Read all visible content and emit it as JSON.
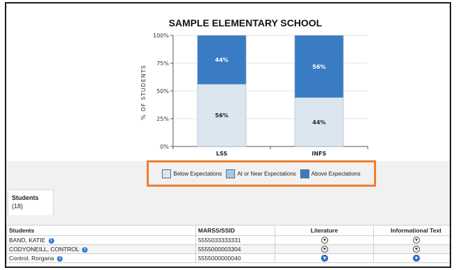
{
  "chart_data": {
    "type": "bar",
    "stacked": true,
    "percent": true,
    "title": "SAMPLE ELEMENTARY SCHOOL",
    "ylabel": "% OF STUDENTS",
    "xlabel": "",
    "ylim": [
      0,
      100
    ],
    "ytick_labels": [
      "0%",
      "25%",
      "50%",
      "75%",
      "100%"
    ],
    "yticks": [
      0,
      25,
      50,
      75,
      100
    ],
    "categories": [
      "LSS",
      "INFS"
    ],
    "series": [
      {
        "name": "Below Expectations",
        "values": [
          56,
          44
        ],
        "color": "#dce6f1",
        "labels": [
          "56%",
          "44%"
        ]
      },
      {
        "name": "At or Near Expectations",
        "values": [
          0,
          0
        ],
        "color": "#a7c7e8",
        "labels": [
          "",
          ""
        ]
      },
      {
        "name": "Above Expectations",
        "values": [
          44,
          56
        ],
        "color": "#3a7cc4",
        "labels": [
          "44%",
          "56%"
        ]
      }
    ],
    "grid": true,
    "legend_position": "bottom"
  },
  "legend": {
    "items": [
      {
        "label": "Below Expectations",
        "color": "#dce6f1"
      },
      {
        "label": "At or Near Expectations",
        "color": "#a7c7e8"
      },
      {
        "label": "Above Expectations",
        "color": "#3a7cc4"
      }
    ]
  },
  "tabs": {
    "active_title": "Students",
    "active_count": "(18)"
  },
  "table": {
    "headers": [
      "Students",
      "MARSS/SSID",
      "Literature",
      "Informational Text"
    ],
    "rows": [
      {
        "name": "BAND, KATIE",
        "id": "5555033333331",
        "lit_icon": "download-icon",
        "info_icon": "download-icon"
      },
      {
        "name": "CODYONEILL, CONTROL",
        "id": "5555000003304",
        "lit_icon": "download-icon",
        "info_icon": "download-icon"
      },
      {
        "name": "Control, Rorgana",
        "id": "5555000000040",
        "lit_icon": "download-icon-filled",
        "info_icon": "download-icon-filled"
      }
    ]
  },
  "colors": {
    "highlight_border": "#ef7d2d",
    "info_icon": "#2f79d1"
  }
}
